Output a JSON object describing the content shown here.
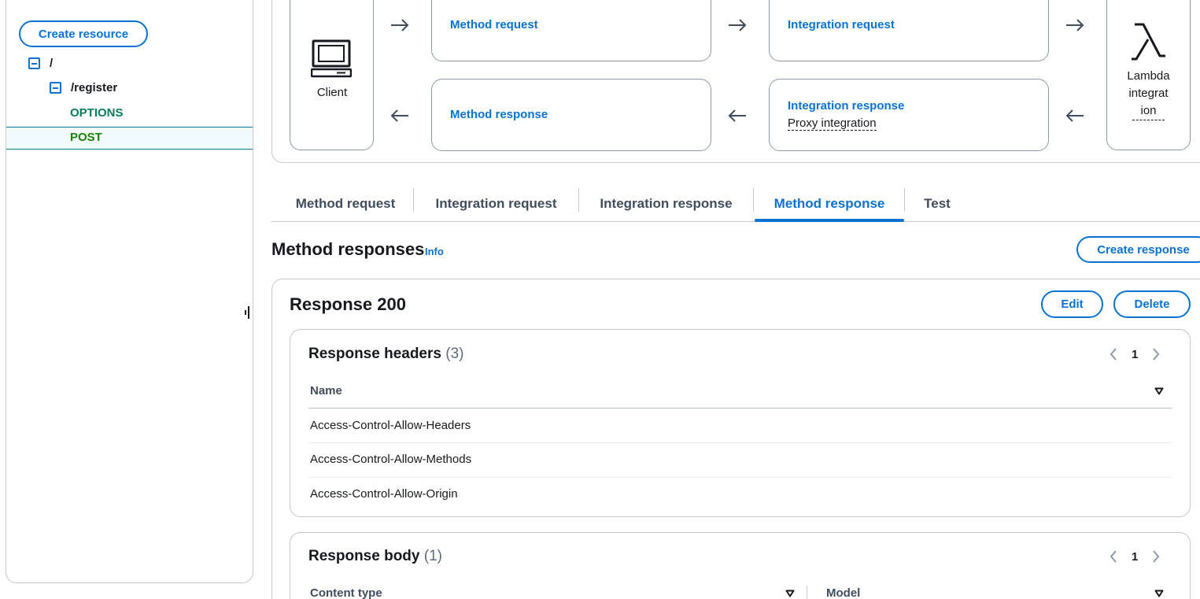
{
  "sidebar": {
    "create_resource_label": "Create resource",
    "tree": {
      "root": "/",
      "child": "/register",
      "methods": [
        "OPTIONS",
        "POST"
      ],
      "selected": "POST"
    }
  },
  "flow": {
    "client_label": "Client",
    "method_request": "Method request",
    "integration_request": "Integration request",
    "method_response": "Method response",
    "integration_response": "Integration response",
    "integration_response_sub": "Proxy integration",
    "lambda_label_lines": [
      "Lambda",
      "integrat",
      "ion"
    ]
  },
  "tabs": [
    {
      "label": "Method request",
      "active": false
    },
    {
      "label": "Integration request",
      "active": false
    },
    {
      "label": "Integration response",
      "active": false
    },
    {
      "label": "Method response",
      "active": true
    },
    {
      "label": "Test",
      "active": false
    }
  ],
  "section": {
    "title": "Method responses",
    "info": "Info",
    "create_response_label": "Create response"
  },
  "response": {
    "title": "Response 200",
    "edit_label": "Edit",
    "delete_label": "Delete",
    "headers": {
      "title": "Response headers",
      "count": "(3)",
      "page": "1",
      "column": "Name",
      "rows": [
        "Access-Control-Allow-Headers",
        "Access-Control-Allow-Methods",
        "Access-Control-Allow-Origin"
      ]
    },
    "body": {
      "title": "Response body",
      "count": "(1)",
      "page": "1",
      "columns": [
        "Content type",
        "Model"
      ]
    }
  },
  "colors": {
    "accent": "#0972d3",
    "text": "#16191f",
    "border": "#c6c6cd",
    "options_method": "#0b7a5a",
    "post_method": "#1d8102",
    "selected_bg": "#f0fbff"
  }
}
